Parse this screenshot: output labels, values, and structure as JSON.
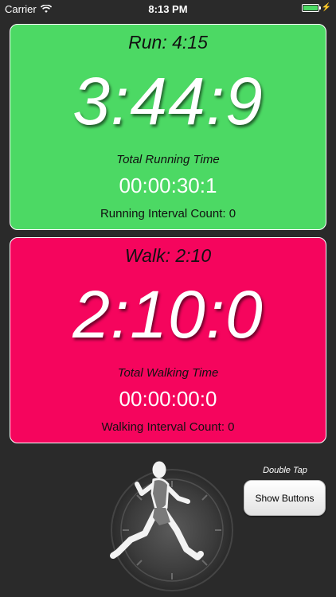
{
  "status_bar": {
    "carrier": "Carrier",
    "time": "8:13 PM",
    "wifi_icon": "wifi-icon",
    "battery_icon": "battery-icon",
    "charging_icon": "bolt-icon",
    "battery_level": 1.0
  },
  "run": {
    "title": "Run:  4:15",
    "timer": "3:44:9",
    "total_label": "Total Running Time",
    "total_value": "00:00:30:1",
    "count_label": "Running Interval Count: 0",
    "color": "#4cd964"
  },
  "walk": {
    "title": "Walk:  2:10",
    "timer": "2:10:0",
    "total_label": "Total Walking Time",
    "total_value": "00:00:00:0",
    "count_label": "Walking Interval Count: 0",
    "color": "#f5055d"
  },
  "bottom": {
    "hint": "Double Tap",
    "show_buttons_label": "Show Buttons",
    "image_icon": "runner-stopwatch-icon"
  }
}
